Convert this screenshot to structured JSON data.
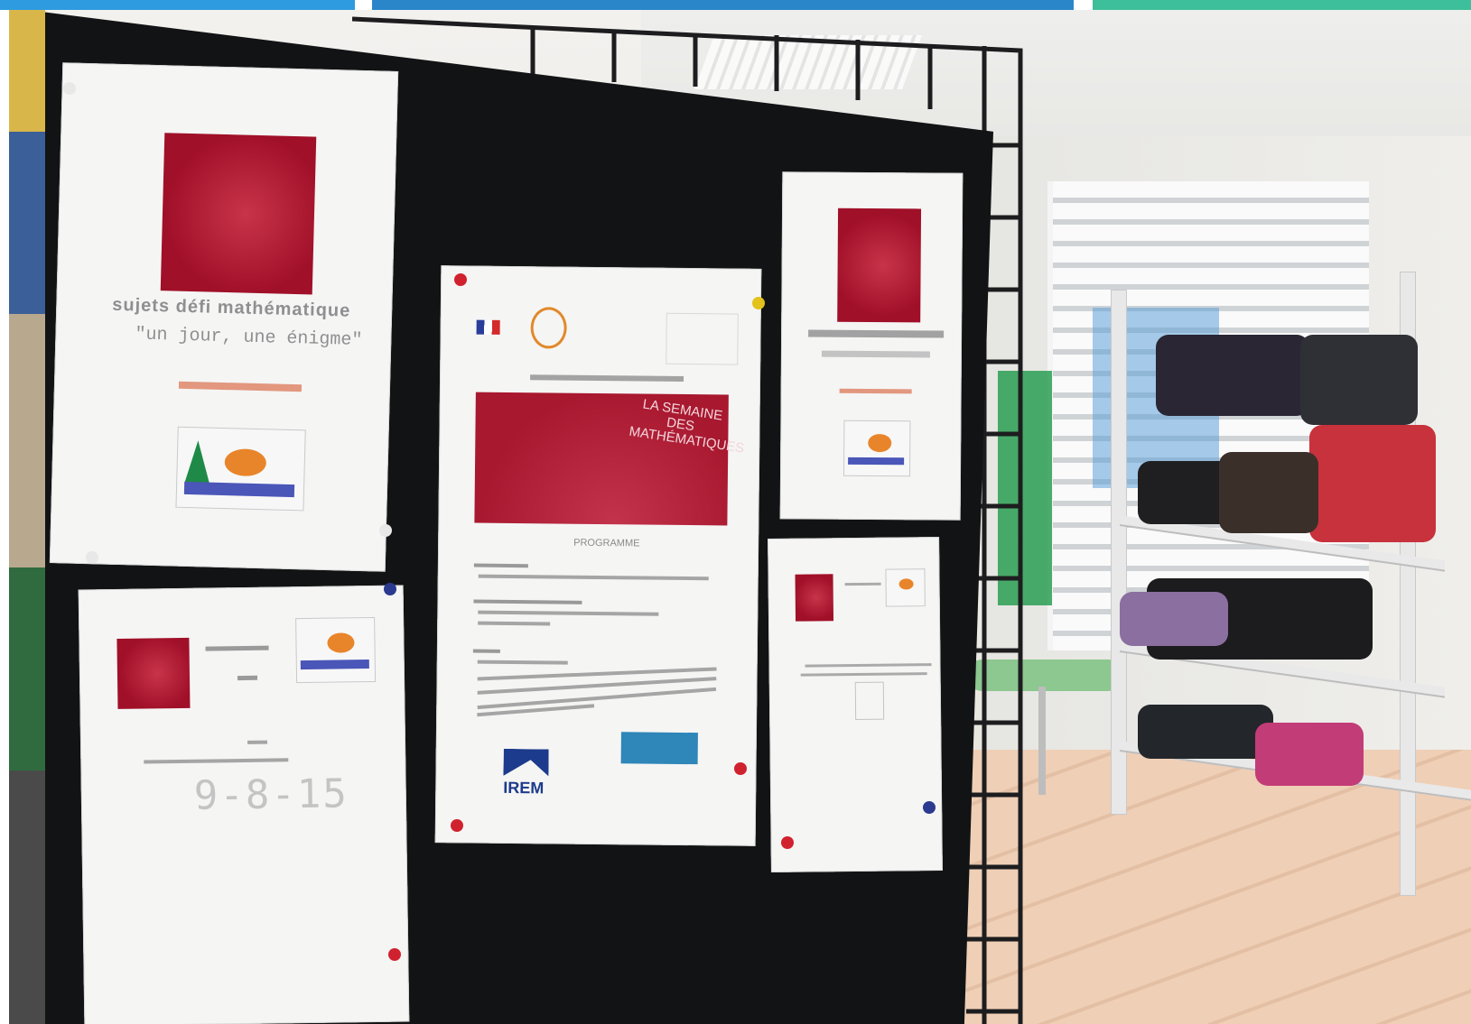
{
  "top_strip": {
    "colors": [
      "#2e9be0",
      "#2a86c9",
      "#3cbf9a"
    ]
  },
  "posters": {
    "left_top": {
      "title": "sujets défi mathématique",
      "subtitle": "\"un jour, une énigme\""
    },
    "center": {
      "banner_text": "LA SEMAINE DES MATHÉMATIQUES",
      "programme_label": "PROGRAMME",
      "logo_irem": "IREM"
    },
    "left_bottom": {
      "number": "9-8-15"
    }
  },
  "icons": [
    "pushpin-icon",
    "math-week-logo-icon",
    "irem-logo-icon",
    "triangle-orange-logo-icon"
  ],
  "colors": {
    "board": "#121314",
    "poster_red": "#a8182f",
    "pins": [
      "#d0222e",
      "#e3c21b",
      "#2b3a8f",
      "#e8e8e8"
    ]
  }
}
